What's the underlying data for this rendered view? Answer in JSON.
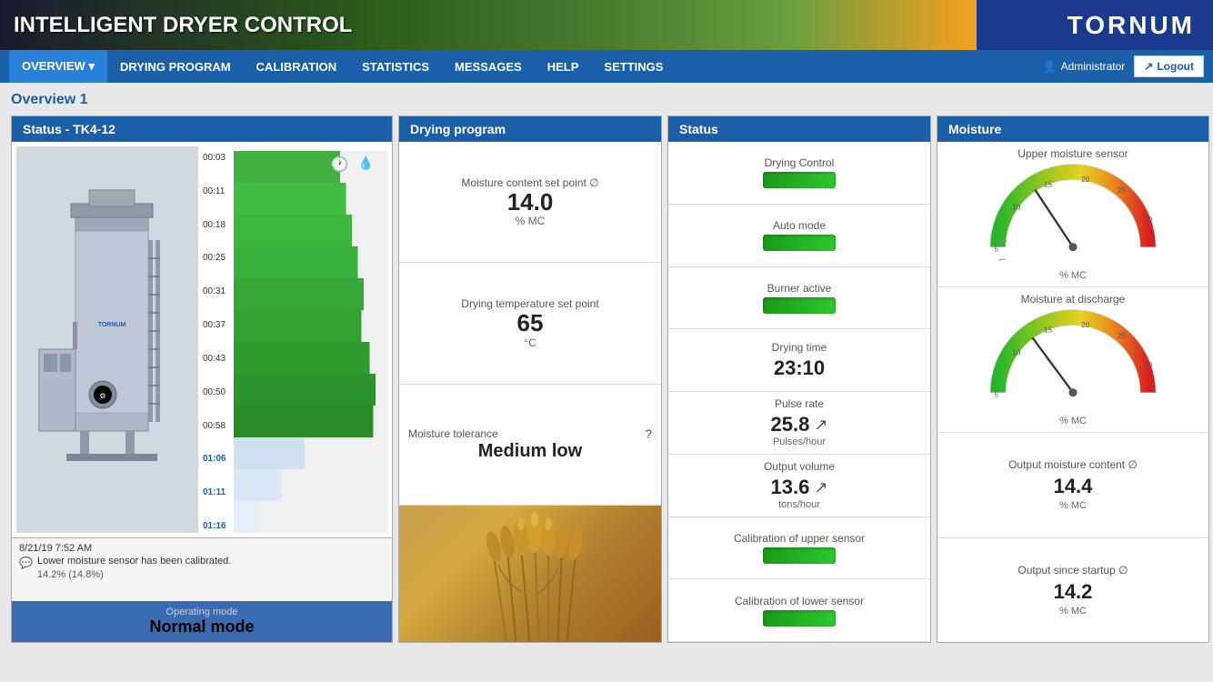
{
  "app": {
    "title": "INTELLIGENT DRYER CONTROL",
    "logo": "TORNUM"
  },
  "nav": {
    "items": [
      {
        "id": "overview",
        "label": "OVERVIEW",
        "active": true,
        "hasDropdown": true
      },
      {
        "id": "drying-program",
        "label": "DRYING PROGRAM",
        "active": false
      },
      {
        "id": "calibration",
        "label": "CALIBRATION",
        "active": false
      },
      {
        "id": "statistics",
        "label": "STATISTICS",
        "active": false
      },
      {
        "id": "messages",
        "label": "MESSAGES",
        "active": false
      },
      {
        "id": "help",
        "label": "HELP",
        "active": false
      },
      {
        "id": "settings",
        "label": "SETTINGS",
        "active": false
      }
    ],
    "user": "Administrator",
    "logout_label": "Logout"
  },
  "page": {
    "title": "Overview 1"
  },
  "status_tk": {
    "panel_title": "Status - TK4-12",
    "time_labels": [
      "00:03",
      "00:11",
      "00:18",
      "00:25",
      "00:31",
      "00:37",
      "00:43",
      "00:50",
      "00:58",
      "01:06",
      "01:11",
      "01:16"
    ],
    "log": {
      "date": "8/21/19 7:52 AM",
      "message": "Lower moisture sensor has been calibrated.",
      "sub": "14.2% (14.8%)"
    },
    "operating_mode_label": "Operating mode",
    "operating_mode_value": "Normal mode"
  },
  "drying_program": {
    "panel_title": "Drying program",
    "moisture_label": "Moisture content set point ∅",
    "moisture_value": "14.0",
    "moisture_unit": "% MC",
    "temp_label": "Drying temperature set point",
    "temp_value": "65",
    "temp_unit": "°C",
    "tolerance_label": "Moisture tolerance",
    "tolerance_value": "Medium low"
  },
  "status": {
    "panel_title": "Status",
    "rows": [
      {
        "label": "Drying Control",
        "type": "indicator"
      },
      {
        "label": "Auto mode",
        "type": "indicator"
      },
      {
        "label": "Burner active",
        "type": "indicator"
      },
      {
        "label": "Drying time",
        "type": "value",
        "value": "23:10",
        "unit": ""
      },
      {
        "label": "Pulse rate",
        "type": "value",
        "value": "25.8",
        "unit": "Pulses/hour",
        "arrow": true
      },
      {
        "label": "Output volume",
        "type": "value",
        "value": "13.6",
        "unit": "tons/hour",
        "arrow": true
      },
      {
        "label": "Calibration of upper sensor",
        "type": "indicator"
      },
      {
        "label": "Calibration of lower sensor",
        "type": "indicator"
      }
    ]
  },
  "moisture": {
    "panel_title": "Moisture",
    "upper_label": "Upper moisture sensor",
    "upper_unit": "% MC",
    "upper_needle_deg": 35,
    "discharge_label": "Moisture at discharge",
    "discharge_unit": "% MC",
    "discharge_needle_deg": 45,
    "output_label": "Output moisture content ∅",
    "output_value": "14.4",
    "output_unit": "% MC",
    "startup_label": "Output since startup ∅",
    "startup_value": "14.2",
    "startup_unit": "% MC",
    "gauge_labels": [
      "5",
      "10",
      "15",
      "20",
      "25",
      "30"
    ],
    "gauge_min": 5,
    "gauge_max": 30
  }
}
